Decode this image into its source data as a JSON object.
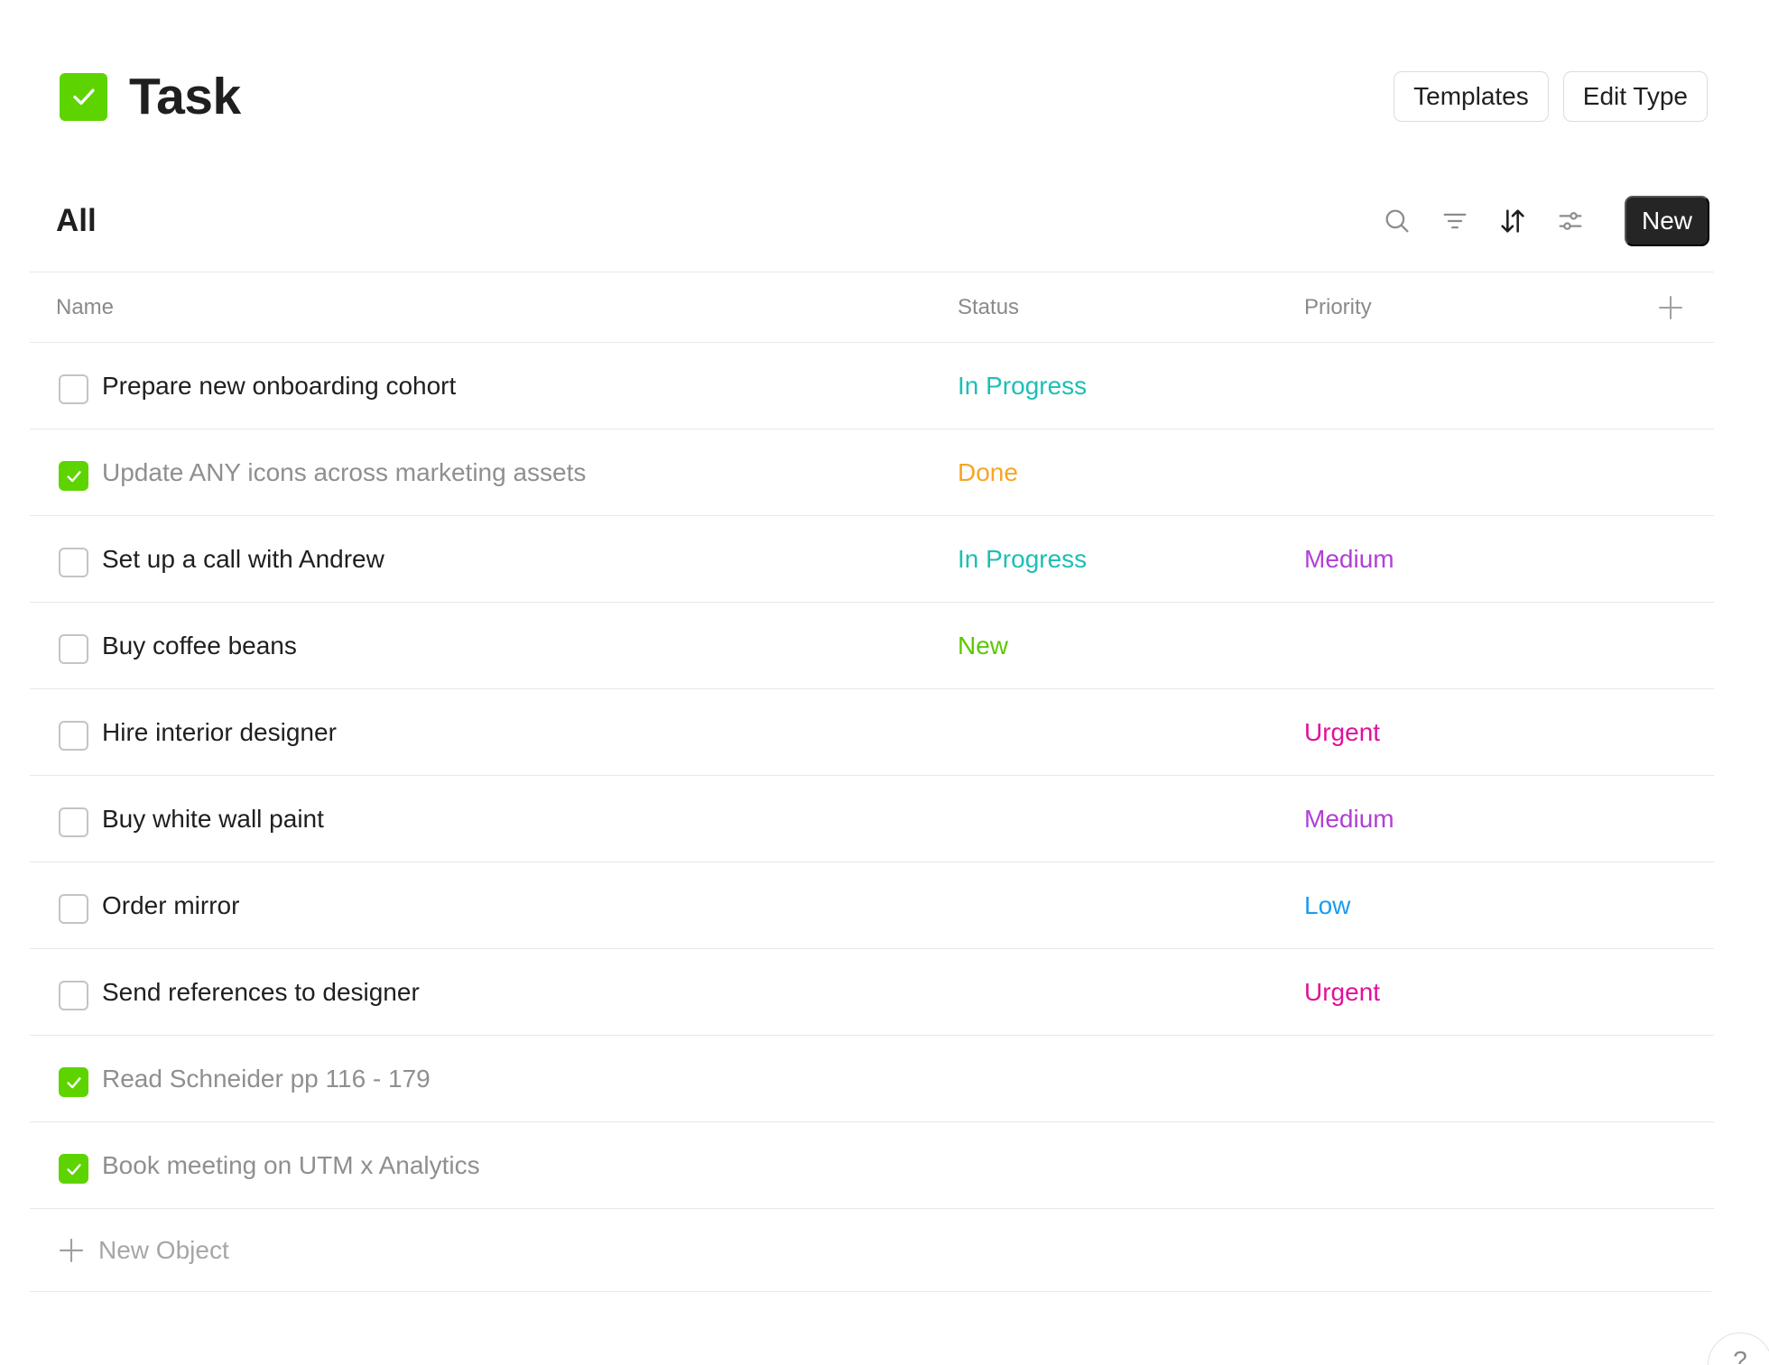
{
  "header": {
    "title": "Task",
    "icon": "check-square-icon",
    "accent_color": "#5dd400",
    "templates_label": "Templates",
    "edit_type_label": "Edit Type"
  },
  "toolbar": {
    "view_title": "All",
    "icons": [
      "search-icon",
      "filter-icon",
      "sort-icon",
      "settings-sliders-icon"
    ],
    "new_label": "New"
  },
  "table": {
    "columns": [
      "Name",
      "Status",
      "Priority"
    ],
    "rows": [
      {
        "name": "Prepare new onboarding cohort",
        "checked": false,
        "status": "In Progress",
        "status_color": "#1cbfb4",
        "priority": "",
        "priority_color": ""
      },
      {
        "name": "Update ANY icons across marketing assets",
        "checked": true,
        "status": "Done",
        "status_color": "#f5a623",
        "priority": "",
        "priority_color": ""
      },
      {
        "name": "Set up a call with Andrew",
        "checked": false,
        "status": "In Progress",
        "status_color": "#1cbfb4",
        "priority": "Medium",
        "priority_color": "#b040d6"
      },
      {
        "name": "Buy coffee beans",
        "checked": false,
        "status": "New",
        "status_color": "#5dc800",
        "priority": "",
        "priority_color": ""
      },
      {
        "name": "Hire interior designer",
        "checked": false,
        "status": "",
        "status_color": "",
        "priority": "Urgent",
        "priority_color": "#e0119b"
      },
      {
        "name": "Buy white wall paint",
        "checked": false,
        "status": "",
        "status_color": "",
        "priority": "Medium",
        "priority_color": "#b040d6"
      },
      {
        "name": "Order mirror",
        "checked": false,
        "status": "",
        "status_color": "",
        "priority": "Low",
        "priority_color": "#1a9cf0"
      },
      {
        "name": "Send references to designer",
        "checked": false,
        "status": "",
        "status_color": "",
        "priority": "Urgent",
        "priority_color": "#e0119b"
      },
      {
        "name": "Read Schneider pp 116 - 179",
        "checked": true,
        "status": "",
        "status_color": "",
        "priority": "",
        "priority_color": ""
      },
      {
        "name": "Book meeting on UTM x Analytics",
        "checked": true,
        "status": "",
        "status_color": "",
        "priority": "",
        "priority_color": ""
      }
    ],
    "new_object_label": "New Object"
  },
  "help": {
    "label": "?"
  }
}
